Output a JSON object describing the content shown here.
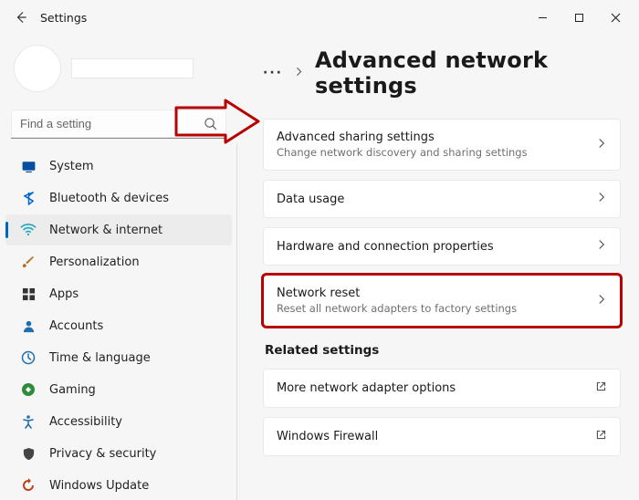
{
  "window": {
    "title": "Settings"
  },
  "search": {
    "placeholder": "Find a setting"
  },
  "sidebar": {
    "items": [
      {
        "label": "System"
      },
      {
        "label": "Bluetooth & devices"
      },
      {
        "label": "Network & internet"
      },
      {
        "label": "Personalization"
      },
      {
        "label": "Apps"
      },
      {
        "label": "Accounts"
      },
      {
        "label": "Time & language"
      },
      {
        "label": "Gaming"
      },
      {
        "label": "Accessibility"
      },
      {
        "label": "Privacy & security"
      },
      {
        "label": "Windows Update"
      }
    ],
    "active_index": 2
  },
  "main": {
    "crumb_dots": "···",
    "page_title": "Advanced network settings",
    "cards": [
      {
        "title": "Advanced sharing settings",
        "sub": "Change network discovery and sharing settings"
      },
      {
        "title": "Data usage",
        "sub": ""
      },
      {
        "title": "Hardware and connection properties",
        "sub": ""
      },
      {
        "title": "Network reset",
        "sub": "Reset all network adapters to factory settings"
      }
    ],
    "related_label": "Related settings",
    "related": [
      {
        "title": "More network adapter options"
      },
      {
        "title": "Windows Firewall"
      }
    ]
  }
}
